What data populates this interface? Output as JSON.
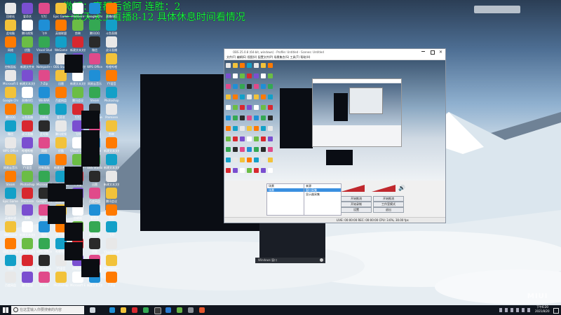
{
  "overlay": {
    "line1": "微博：魔都后爸阿        连胜：2",
    "line2": "一般天天上直播8-12 具体休息时间看情况"
  },
  "obs": {
    "title": "OBS 25.0.8 (64-bit, windows) - Profile: Untitled - Scenes: Untitled",
    "menu": "文件(F)  编辑(E)  视图(V)  配置文件(P)  场景集合(S)  工具(T)  帮助(H)",
    "scenes_header": "场景",
    "sources_header": "来源",
    "scene_item": "场景",
    "source_items": [
      "窗口采集",
      "显示器采集"
    ],
    "buttons": [
      "开始推流",
      "开始录制",
      "工作室模式",
      "设置",
      "退出"
    ],
    "status": "LIVE: 00:00:00   REC: 00:00:00   CPU: 3.6%, 30.00 fps"
  },
  "taskbar": {
    "search_placeholder": "在这里输入你要搜索的内容",
    "time": "下午6:20",
    "date": "2021/8/20"
  },
  "bottom_window_label": "Windows 窗口",
  "desktop_icons": [
    "回收站",
    "此电脑",
    "网络",
    "控制面板",
    "Microsoft Edge",
    "Google Chrome",
    "腾讯QQ",
    "微信",
    "WPS Office",
    "网易云音乐",
    "Steam",
    "Epic Games",
    "英雄联盟",
    "WeGame",
    "OBS Studio",
    "迅雷",
    "百度网盘",
    "爱奇艺",
    "腾讯视频",
    "优酷",
    "新建文件夹",
    "新建文本文档",
    "直播伴侣",
    "斗鱼直播",
    "虎牙直播",
    "哔哩哔哩",
    "YY语音",
    "Photoshop",
    "Premiere",
    "剪映",
    "新建文本文档 (2)",
    "新建文本文档 (3)",
    "新建文本文档 (4)",
    "腾讯会议",
    "钉钉",
    "飞书",
    "Visual Studio Code",
    "Notepad++",
    "7-Zip",
    "WinRAR"
  ],
  "watermark": "MIUI"
}
